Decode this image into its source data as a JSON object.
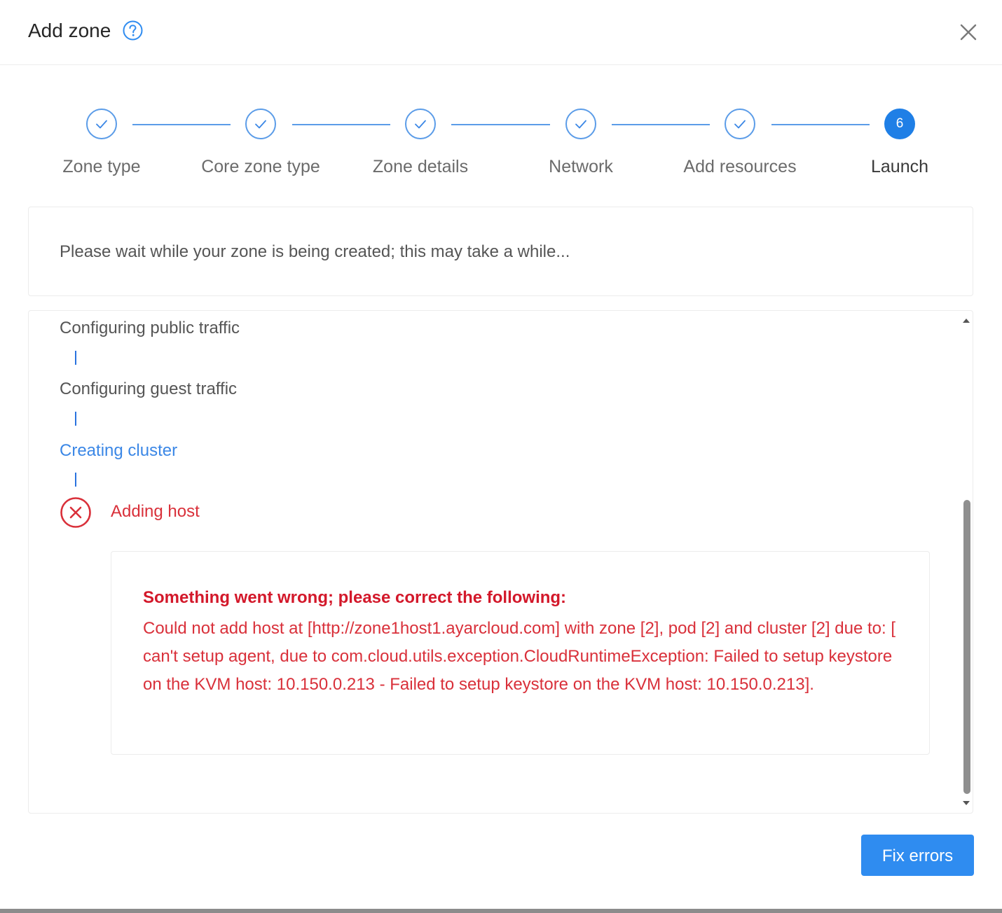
{
  "dialog": {
    "title": "Add zone",
    "help_icon": "question-circle-icon",
    "close_icon": "close-icon"
  },
  "steps": [
    {
      "label": "Zone type",
      "status": "done"
    },
    {
      "label": "Core zone type",
      "status": "done"
    },
    {
      "label": "Zone details",
      "status": "done"
    },
    {
      "label": "Network",
      "status": "done"
    },
    {
      "label": "Add resources",
      "status": "done"
    },
    {
      "label": "Launch",
      "status": "active",
      "number": "6"
    }
  ],
  "info": {
    "message": "Please wait while your zone is being created; this may take a while..."
  },
  "progress": {
    "items": [
      {
        "label": "Configuring public traffic",
        "status": "done"
      },
      {
        "label": "Configuring guest traffic",
        "status": "done"
      },
      {
        "label": "Creating cluster",
        "status": "current"
      },
      {
        "label": "Adding host",
        "status": "error"
      }
    ],
    "error": {
      "title": "Something went wrong; please correct the following:",
      "message": "Could not add host at [http://zone1host1.ayarcloud.com] with zone [2], pod [2] and cluster [2] due to: [ can't setup agent, due to com.cloud.utils.exception.CloudRuntimeException: Failed to setup keystore on the KVM host: 10.150.0.213 - Failed to setup keystore on the KVM host: 10.150.0.213]."
    }
  },
  "footer": {
    "fix_button": "Fix errors"
  },
  "colors": {
    "primary": "#1f7fe6",
    "error": "#d9303a",
    "step_done": "#5b9ce8"
  }
}
